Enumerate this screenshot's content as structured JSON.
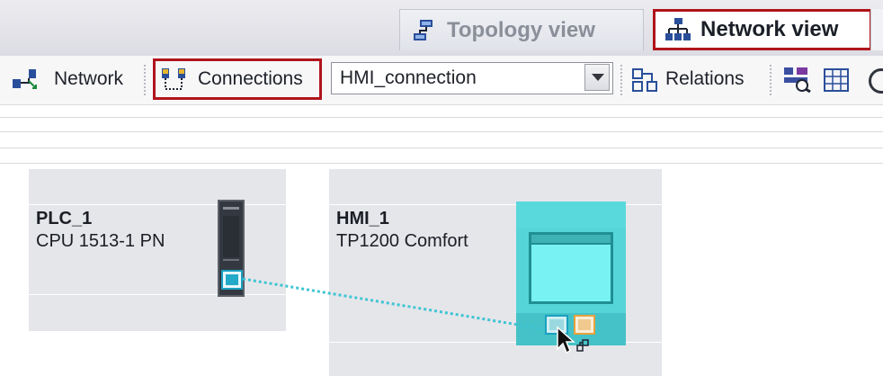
{
  "tabs": {
    "topology_label": "Topology view",
    "network_label": "Network view"
  },
  "toolbar": {
    "network_label": "Network",
    "connections_label": "Connections",
    "connection_type_value": "HMI_connection",
    "relations_label": "Relations"
  },
  "devices": {
    "plc": {
      "name": "PLC_1",
      "type": "CPU 1513-1 PN"
    },
    "hmi": {
      "name": "HMI_1",
      "type": "TP1200 Comfort"
    }
  },
  "colors": {
    "highlight": "#b0141c",
    "screen_cyan": "#5fdfe0",
    "connection_line": "#40c4d4",
    "port_orange": "#e8a23c"
  }
}
